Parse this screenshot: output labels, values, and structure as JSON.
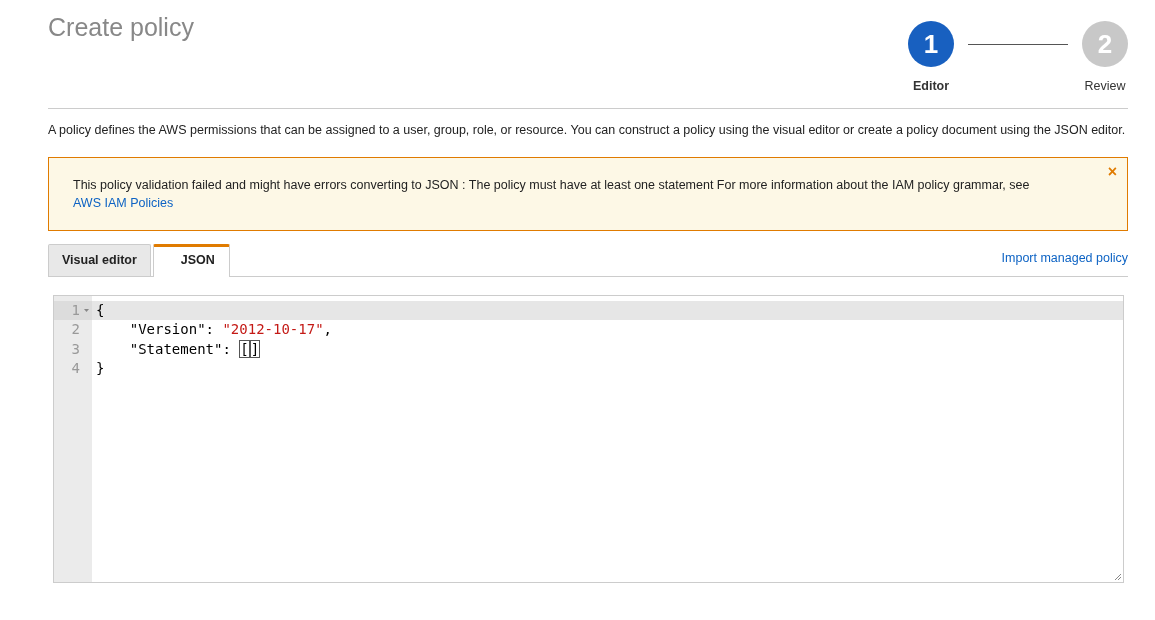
{
  "title": "Create policy",
  "steps": [
    {
      "number": "1",
      "label": "Editor",
      "selected": true
    },
    {
      "number": "2",
      "label": "Review",
      "selected": false
    }
  ],
  "description": "A policy defines the AWS permissions that can be assigned to a user, group, role, or resource. You can construct a policy using the visual editor or create a policy document using the JSON editor.",
  "alert": {
    "message": "This policy validation failed and might have errors converting to JSON : The policy must have at least one statement For more information about the IAM policy grammar, see",
    "link": "AWS IAM Policies",
    "close": "×"
  },
  "tabs": [
    {
      "label": "Visual editor",
      "selected": false
    },
    {
      "label": "JSON",
      "selected": true
    }
  ],
  "import_link": "Import managed policy",
  "editor": {
    "lines": [
      {
        "number": "1",
        "foldable": true,
        "active": true,
        "tokens": [
          {
            "kind": "text",
            "text": "{"
          }
        ]
      },
      {
        "number": "2",
        "foldable": false,
        "active": false,
        "tokens": [
          {
            "kind": "text",
            "text": "    \"Version\": "
          },
          {
            "kind": "string",
            "text": "\"2012-10-17\""
          },
          {
            "kind": "text",
            "text": ","
          }
        ]
      },
      {
        "number": "3",
        "foldable": false,
        "active": false,
        "tokens": [
          {
            "kind": "text",
            "text": "    \"Statement\": "
          },
          {
            "kind": "bracket",
            "text": "["
          },
          {
            "kind": "bracket",
            "text": "]"
          }
        ]
      },
      {
        "number": "4",
        "foldable": false,
        "active": false,
        "tokens": [
          {
            "kind": "text",
            "text": "}"
          }
        ]
      }
    ]
  }
}
